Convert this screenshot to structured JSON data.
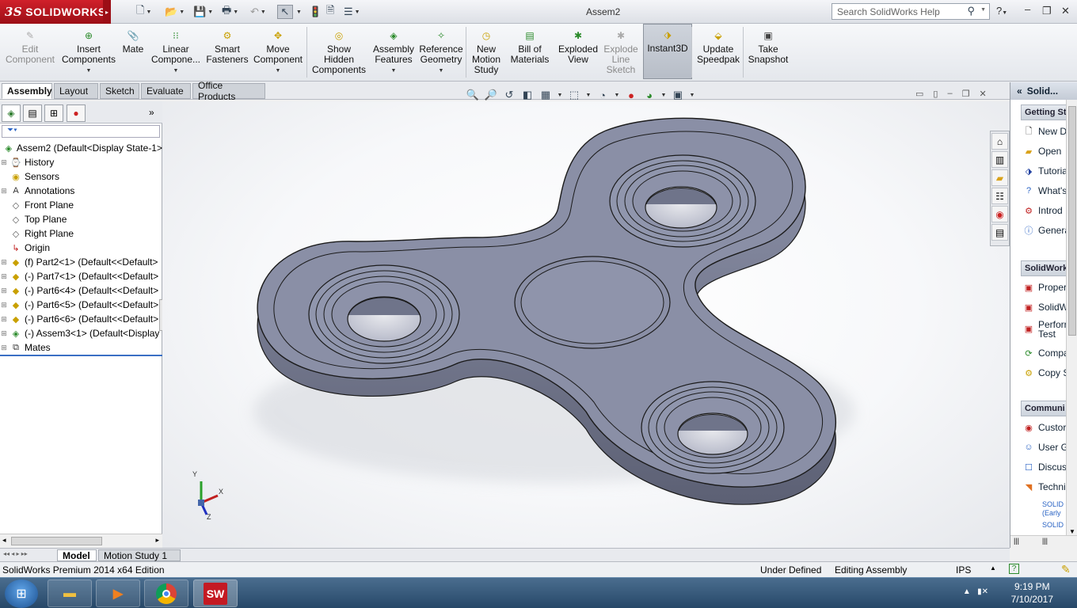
{
  "app": {
    "brand": "SOLIDWORKS",
    "brand_prefix": "3S",
    "document_title": "Assem2",
    "search_placeholder": "Search SolidWorks Help",
    "help_icon": "?"
  },
  "command_manager": [
    {
      "id": "edit-component",
      "label": [
        "Edit",
        "Component"
      ],
      "icon": "edit-component-icon",
      "disabled": true
    },
    {
      "id": "insert-components",
      "label": [
        "Insert",
        "Components"
      ],
      "icon": "insert-components-icon",
      "dropdown": true
    },
    {
      "id": "mate",
      "label": [
        "Mate"
      ],
      "icon": "mate-icon"
    },
    {
      "id": "linear-component",
      "label": [
        "Linear",
        "Compone..."
      ],
      "icon": "linear-pattern-icon",
      "dropdown": true
    },
    {
      "id": "smart-fasteners",
      "label": [
        "Smart",
        "Fasteners"
      ],
      "icon": "smart-fasteners-icon"
    },
    {
      "id": "move-component",
      "label": [
        "Move",
        "Component"
      ],
      "icon": "move-component-icon",
      "dropdown": true
    },
    {
      "id": "show-hidden",
      "label": [
        "Show",
        "Hidden",
        "Components"
      ],
      "icon": "show-hidden-icon"
    },
    {
      "id": "assembly-features",
      "label": [
        "Assembly",
        "Features"
      ],
      "icon": "assembly-features-icon",
      "dropdown": true
    },
    {
      "id": "reference-geometry",
      "label": [
        "Reference",
        "Geometry"
      ],
      "icon": "reference-geometry-icon",
      "dropdown": true
    },
    {
      "id": "new-motion-study",
      "label": [
        "New",
        "Motion",
        "Study"
      ],
      "icon": "motion-study-icon"
    },
    {
      "id": "bill-of-materials",
      "label": [
        "Bill of",
        "Materials"
      ],
      "icon": "bill-of-materials-icon"
    },
    {
      "id": "exploded-view",
      "label": [
        "Exploded",
        "View"
      ],
      "icon": "exploded-view-icon"
    },
    {
      "id": "explode-line-sketch",
      "label": [
        "Explode",
        "Line",
        "Sketch"
      ],
      "icon": "explode-line-icon",
      "disabled": true
    },
    {
      "id": "instant3d",
      "label": [
        "Instant3D"
      ],
      "icon": "instant3d-icon",
      "active": true
    },
    {
      "id": "update-speedpak",
      "label": [
        "Update",
        "Speedpak"
      ],
      "icon": "speedpak-icon"
    },
    {
      "id": "take-snapshot",
      "label": [
        "Take",
        "Snapshot"
      ],
      "icon": "snapshot-icon"
    }
  ],
  "tabs": [
    "Assembly",
    "Layout",
    "Sketch",
    "Evaluate",
    "Office Products"
  ],
  "active_tab": "Assembly",
  "feature_tree": [
    {
      "label": "Assem2  (Default<Display State-1>",
      "icon": "assembly-icon",
      "expand": ""
    },
    {
      "label": "History",
      "icon": "history-icon",
      "expand": "+"
    },
    {
      "label": "Sensors",
      "icon": "sensors-icon",
      "expand": ""
    },
    {
      "label": "Annotations",
      "icon": "annotations-icon",
      "expand": "+"
    },
    {
      "label": "Front Plane",
      "icon": "plane-icon",
      "expand": ""
    },
    {
      "label": "Top Plane",
      "icon": "plane-icon",
      "expand": ""
    },
    {
      "label": "Right Plane",
      "icon": "plane-icon",
      "expand": ""
    },
    {
      "label": "Origin",
      "icon": "origin-icon",
      "expand": ""
    },
    {
      "label": "(f) Part2<1> (Default<<Default>",
      "icon": "part-icon",
      "expand": "+"
    },
    {
      "label": "(-) Part7<1> (Default<<Default>",
      "icon": "part-icon",
      "expand": "+"
    },
    {
      "label": "(-) Part6<4> (Default<<Default>",
      "icon": "part-icon",
      "expand": "+"
    },
    {
      "label": "(-) Part6<5> (Default<<Default>",
      "icon": "part-icon",
      "expand": "+"
    },
    {
      "label": "(-) Part6<6> (Default<<Default>",
      "icon": "part-icon",
      "expand": "+"
    },
    {
      "label": "(-) Assem3<1> (Default<Display",
      "icon": "subassembly-icon",
      "expand": "+"
    },
    {
      "label": "Mates",
      "icon": "mates-icon",
      "expand": "+"
    }
  ],
  "bottom_tabs": [
    "Model",
    "Motion Study 1"
  ],
  "taskpane": {
    "title": "Solid...",
    "sections": [
      {
        "title": "Getting St",
        "items": [
          "New D",
          "Open",
          "Tutoria",
          "What's",
          "Introd",
          "Genera"
        ]
      },
      {
        "title": "SolidWork",
        "items": [
          "Proper",
          "SolidW",
          "Perforr Test",
          "Compa",
          "Copy S"
        ]
      },
      {
        "title": "Communi",
        "items": [
          "Custor",
          "User G",
          "Discus",
          "Techni"
        ],
        "links": [
          "SOLID (Early",
          "SOLID"
        ]
      }
    ]
  },
  "triad": {
    "x": "X",
    "y": "Y",
    "z": "Z"
  },
  "status": {
    "edition": "SolidWorks Premium 2014 x64 Edition",
    "definition": "Under Defined",
    "mode": "Editing Assembly",
    "units": "IPS"
  },
  "taskbar": {
    "time": "9:19 PM",
    "date": "7/10/2017",
    "apps": [
      "windows-explorer",
      "media-player",
      "chrome",
      "solidworks"
    ]
  },
  "colors": {
    "model_face": "#8a8fa6",
    "model_edge": "#1a1a1a",
    "brand_red": "#c41a23",
    "taskbar": "#2f5377"
  }
}
